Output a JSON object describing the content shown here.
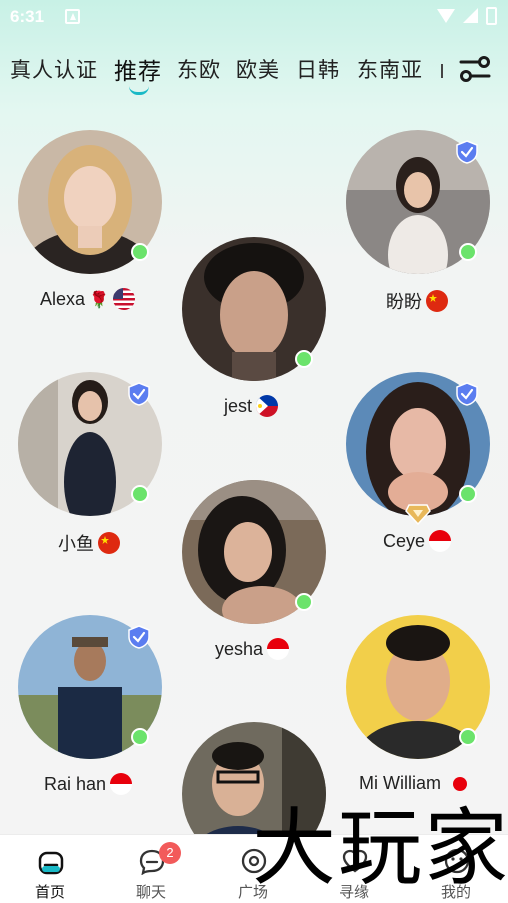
{
  "status_bar": {
    "time": "6:31"
  },
  "tabs": [
    {
      "label": "真人认证"
    },
    {
      "label": "推荐"
    },
    {
      "label": "东欧"
    },
    {
      "label": "欧美"
    },
    {
      "label": "日韩"
    },
    {
      "label": "东南亚"
    }
  ],
  "active_tab": "推荐",
  "users": [
    {
      "name": "Alexa",
      "emoji": "🌹",
      "flag": "US",
      "online": true,
      "verified": false
    },
    {
      "name": "盼盼",
      "flag": "CN",
      "online": true,
      "verified": true
    },
    {
      "name": "jest",
      "flag": "PH",
      "online": true,
      "verified": false
    },
    {
      "name": "小鱼",
      "flag": "CN",
      "online": true,
      "verified": true
    },
    {
      "name": "Ceye",
      "flag": "ID",
      "online": true,
      "verified": true,
      "diamond": true
    },
    {
      "name": "yesha",
      "flag": "ID",
      "online": true,
      "verified": false
    },
    {
      "name": "Rai han",
      "flag": "ID",
      "online": true,
      "verified": true
    },
    {
      "name": "Mi William",
      "flag": "JP",
      "online": true,
      "verified": false
    },
    {
      "name": "",
      "online": false,
      "verified": false
    }
  ],
  "bottom_nav": {
    "home": "首页",
    "chat": "聊天",
    "chat_badge": "2",
    "plaza": "广场",
    "match": "寻缘",
    "mine": "我的"
  },
  "watermark": "大玩家",
  "colors": {
    "accent": "#19b9c6",
    "online": "#6be36b",
    "badge": "#f25a5a",
    "verified": "#5b7df0"
  }
}
